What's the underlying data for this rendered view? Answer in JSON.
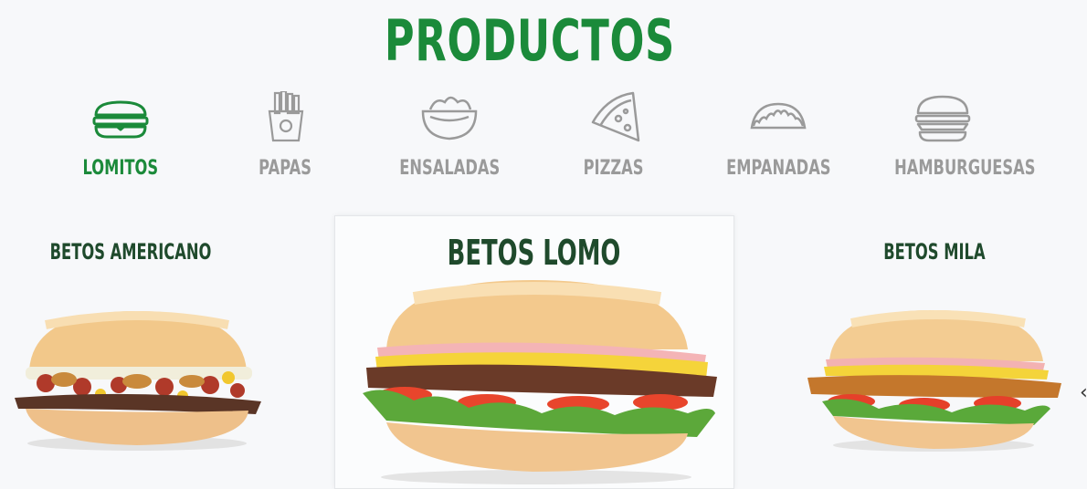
{
  "page_title": "PRODUCTOS",
  "categories": [
    {
      "label": "LOMITOS",
      "icon": "sandwich-icon",
      "active": true
    },
    {
      "label": "PAPAS",
      "icon": "fries-icon",
      "active": false
    },
    {
      "label": "ENSALADAS",
      "icon": "salad-bowl-icon",
      "active": false
    },
    {
      "label": "PIZZAS",
      "icon": "pizza-slice-icon",
      "active": false
    },
    {
      "label": "EMPANADAS",
      "icon": "empanada-icon",
      "active": false
    },
    {
      "label": "HAMBURGUESAS",
      "icon": "burger-icon",
      "active": false
    }
  ],
  "products": [
    {
      "name": "BETOS AMERICANO",
      "featured": false
    },
    {
      "name": "BETOS LOMO",
      "featured": true
    },
    {
      "name": "BETOS MILA",
      "featured": false
    }
  ],
  "colors": {
    "accent": "#1b8a3a",
    "inactive": "#9a9a9a",
    "product_name": "#1f4a2c"
  },
  "next_arrow": "‹"
}
